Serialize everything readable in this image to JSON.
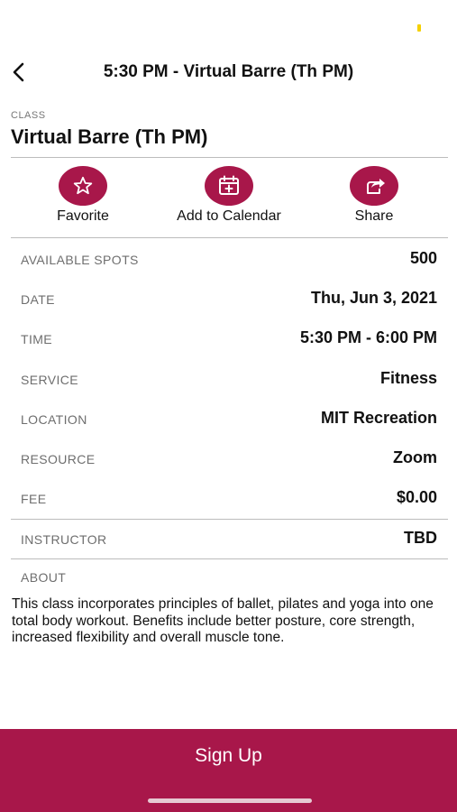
{
  "nav": {
    "title": "5:30 PM - Virtual Barre (Th PM)"
  },
  "class": {
    "label": "CLASS",
    "name": "Virtual Barre (Th PM)"
  },
  "actions": [
    {
      "label": "Favorite",
      "icon": "star-icon"
    },
    {
      "label": "Add to Calendar",
      "icon": "calendar-add-icon"
    },
    {
      "label": "Share",
      "icon": "share-icon"
    }
  ],
  "details": [
    {
      "label": "AVAILABLE SPOTS",
      "value": "500"
    },
    {
      "label": "DATE",
      "value": "Thu, Jun 3, 2021"
    },
    {
      "label": "TIME",
      "value": "5:30 PM - 6:00 PM"
    },
    {
      "label": "SERVICE",
      "value": "Fitness"
    },
    {
      "label": "LOCATION",
      "value": "MIT Recreation"
    },
    {
      "label": "RESOURCE",
      "value": "Zoom"
    },
    {
      "label": "FEE",
      "value": "$0.00"
    },
    {
      "label": "INSTRUCTOR",
      "value": "TBD"
    }
  ],
  "about": {
    "label": "ABOUT",
    "text": "This class incorporates principles of ballet, pilates and yoga into one total body workout. Benefits include better posture, core strength, increased flexibility and overall muscle tone."
  },
  "signup": {
    "label": "Sign Up"
  },
  "colors": {
    "accent": "#a8174a",
    "status_dot": "#f5d000"
  }
}
